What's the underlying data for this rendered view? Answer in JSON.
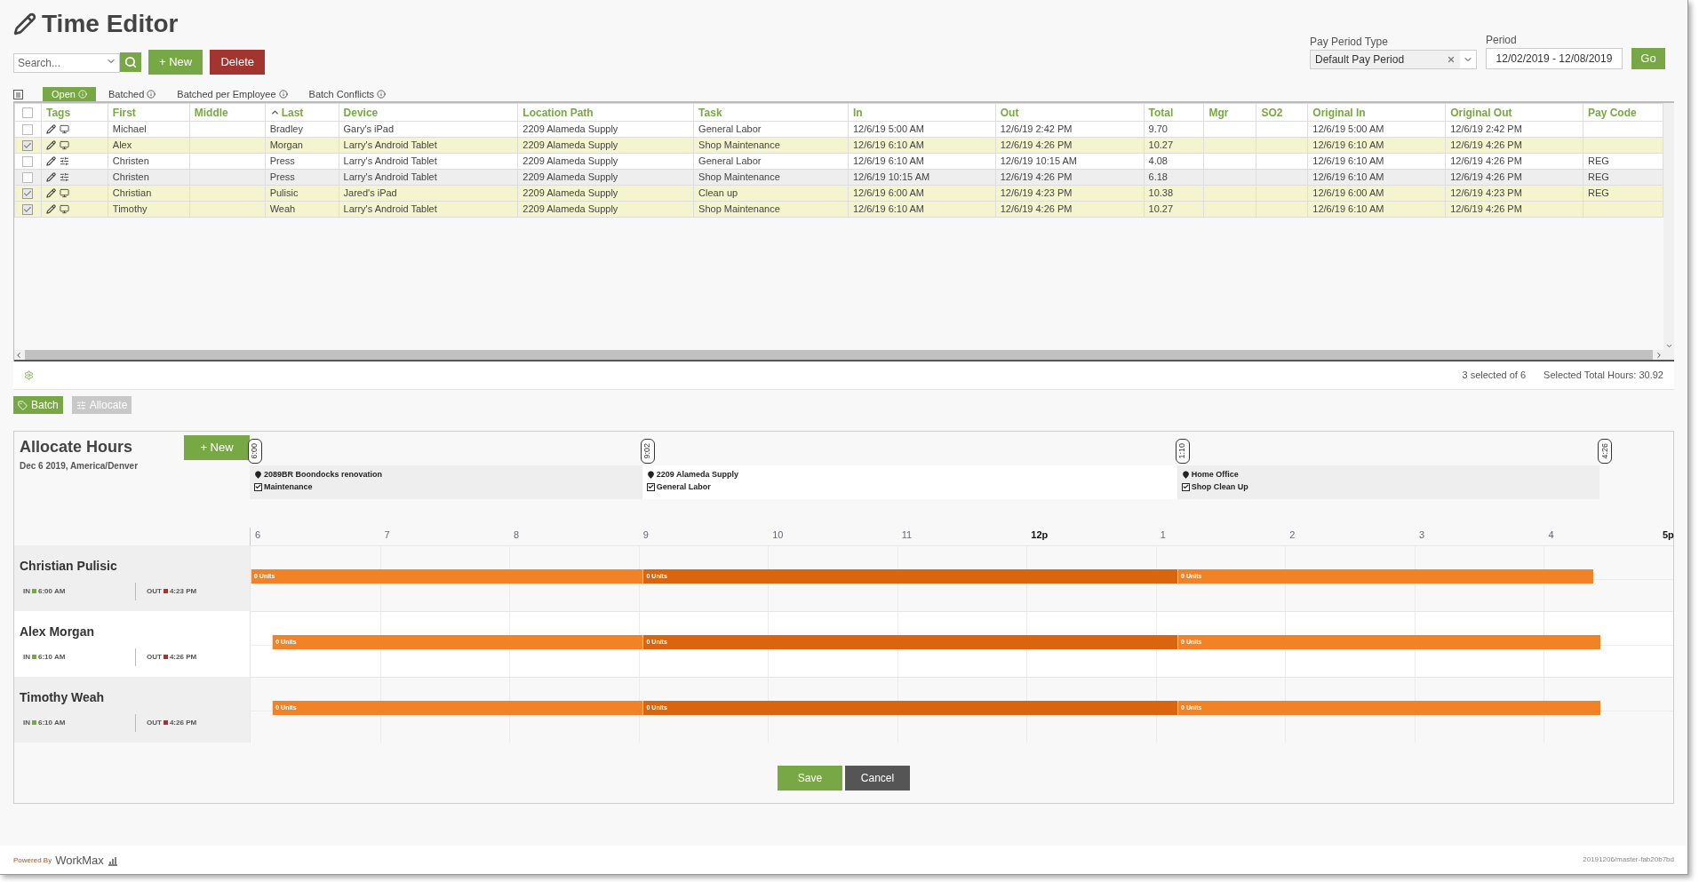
{
  "header": {
    "title": "Time Editor"
  },
  "toolbar": {
    "search": {
      "placeholder": "Search..."
    },
    "buttons": [
      {
        "label": "+ New",
        "kind": "new"
      },
      {
        "label": "Delete",
        "kind": "delete"
      }
    ]
  },
  "filters": {
    "pay_period_type": {
      "label": "Pay Period Type",
      "value": "Default Pay Period"
    },
    "period": {
      "label": "Period",
      "value": "12/02/2019 - 12/08/2019"
    },
    "go": "Go"
  },
  "tabs": [
    {
      "label": "Open",
      "selected": true
    },
    {
      "label": "Batched",
      "selected": false
    },
    {
      "label": "Batched per Employee",
      "selected": false
    },
    {
      "label": "Batch Conflicts",
      "selected": false
    }
  ],
  "table": {
    "select_all": false,
    "columns": [
      {
        "label": "Tags",
        "sorted": false
      },
      {
        "label": "First",
        "sorted": false
      },
      {
        "label": "Middle",
        "sorted": false
      },
      {
        "label": "Last",
        "sorted": true
      },
      {
        "label": "Device",
        "sorted": false
      },
      {
        "label": "Location Path",
        "sorted": false
      },
      {
        "label": "Task",
        "sorted": false
      },
      {
        "label": "In",
        "sorted": false
      },
      {
        "label": "Out",
        "sorted": false
      },
      {
        "label": "Total",
        "sorted": false
      },
      {
        "label": "Mgr",
        "sorted": false
      },
      {
        "label": "SO2",
        "sorted": false
      },
      {
        "label": "Original In",
        "sorted": false
      },
      {
        "label": "Original Out",
        "sorted": false
      },
      {
        "label": "Pay Code",
        "sorted": false
      }
    ],
    "rows": [
      {
        "selected": false,
        "hovered": false,
        "kind": "device",
        "cells": [
          "",
          "Michael",
          "",
          "Bradley",
          "Gary's iPad",
          "2209 Alameda Supply",
          "General Labor",
          "12/6/19 5:00 AM",
          "12/6/19 2:42 PM",
          "9.70",
          "",
          "",
          "12/6/19 5:00 AM",
          "12/6/19 2:42 PM",
          ""
        ]
      },
      {
        "selected": true,
        "hovered": false,
        "kind": "device",
        "cells": [
          "",
          "Alex",
          "",
          "Morgan",
          "Larry's Android Tablet",
          "2209 Alameda Supply",
          "Shop Maintenance",
          "12/6/19 6:10 AM",
          "12/6/19 4:26 PM",
          "10.27",
          "",
          "",
          "12/6/19 6:10 AM",
          "12/6/19 4:26 PM",
          ""
        ]
      },
      {
        "selected": false,
        "hovered": false,
        "kind": "adjusted",
        "cells": [
          "",
          "Christen",
          "",
          "Press",
          "Larry's Android Tablet",
          "2209 Alameda Supply",
          "General Labor",
          "12/6/19 6:10 AM",
          "12/6/19 10:15 AM",
          "4.08",
          "",
          "",
          "12/6/19 6:10 AM",
          "12/6/19 4:26 PM",
          "REG"
        ]
      },
      {
        "selected": false,
        "hovered": true,
        "kind": "adjusted",
        "cells": [
          "",
          "Christen",
          "",
          "Press",
          "Larry's Android Tablet",
          "2209 Alameda Supply",
          "Shop Maintenance",
          "12/6/19 10:15 AM",
          "12/6/19 4:26 PM",
          "6.18",
          "",
          "",
          "12/6/19 6:10 AM",
          "12/6/19 4:26 PM",
          "REG"
        ]
      },
      {
        "selected": true,
        "hovered": false,
        "kind": "device",
        "cells": [
          "",
          "Christian",
          "",
          "Pulisic",
          "Jared's iPad",
          "2209 Alameda Supply",
          "Clean up",
          "12/6/19 6:00 AM",
          "12/6/19 4:23 PM",
          "10.38",
          "",
          "",
          "12/6/19 6:00 AM",
          "12/6/19 4:23 PM",
          "REG"
        ]
      },
      {
        "selected": true,
        "hovered": false,
        "kind": "device",
        "cells": [
          "",
          "Timothy",
          "",
          "Weah",
          "Larry's Android Tablet",
          "2209 Alameda Supply",
          "Shop Maintenance",
          "12/6/19 6:10 AM",
          "12/6/19 4:26 PM",
          "10.27",
          "",
          "",
          "12/6/19 6:10 AM",
          "12/6/19 4:26 PM",
          ""
        ]
      }
    ]
  },
  "status": {
    "selection": "3 selected of 6",
    "total": "Selected Total Hours: 30.92"
  },
  "actions": [
    {
      "label": "Batch",
      "kind": "batch",
      "disabled": false
    },
    {
      "label": "Allocate",
      "kind": "allocate",
      "disabled": true
    }
  ],
  "allocate": {
    "title": "Allocate Hours",
    "subtitle": "Dec 6 2019, America/Denver",
    "new_button": "+ New",
    "markers": [
      "6:00",
      "9:02",
      "1:10",
      "4:26"
    ],
    "allocations": [
      {
        "location": "2089BR Boondocks renovation",
        "task": "Maintenance",
        "checked": true,
        "shaded": true
      },
      {
        "location": "2209 Alameda Supply",
        "task": "General Labor",
        "checked": true,
        "shaded": false
      },
      {
        "location": "Home Office",
        "task": "Shop Clean Up",
        "checked": true,
        "shaded": true
      }
    ],
    "hours": [
      {
        "label": "6",
        "bold": false
      },
      {
        "label": "7",
        "bold": false
      },
      {
        "label": "8",
        "bold": false
      },
      {
        "label": "9",
        "bold": false
      },
      {
        "label": "10",
        "bold": false
      },
      {
        "label": "11",
        "bold": false
      },
      {
        "label": "12p",
        "bold": true
      },
      {
        "label": "1",
        "bold": false
      },
      {
        "label": "2",
        "bold": false
      },
      {
        "label": "3",
        "bold": false
      },
      {
        "label": "4",
        "bold": false
      },
      {
        "label": "5p",
        "bold": true
      }
    ],
    "employees": [
      {
        "name": "Christian Pulisic",
        "in_label": "IN",
        "in": "6:00 AM",
        "out_label": "OUT",
        "out": "4:23 PM",
        "shaded": true,
        "segments": [
          {
            "label": "0 Units",
            "color": "#f28226"
          },
          {
            "label": "0 Units",
            "color": "#d9650e"
          },
          {
            "label": "0 Units",
            "color": "#f28226"
          }
        ]
      },
      {
        "name": "Alex Morgan",
        "in_label": "IN",
        "in": "6:10 AM",
        "out_label": "OUT",
        "out": "4:26 PM",
        "shaded": false,
        "segments": [
          {
            "label": "0 Units",
            "color": "#f28226"
          },
          {
            "label": "0 Units",
            "color": "#d9650e"
          },
          {
            "label": "0 Units",
            "color": "#f28226"
          }
        ]
      },
      {
        "name": "Timothy Weah",
        "in_label": "IN",
        "in": "6:10 AM",
        "out_label": "OUT",
        "out": "4:26 PM",
        "shaded": true,
        "segments": [
          {
            "label": "0 Units",
            "color": "#f28226"
          },
          {
            "label": "0 Units",
            "color": "#d9650e"
          },
          {
            "label": "0 Units",
            "color": "#f28226"
          }
        ]
      }
    ]
  },
  "form_buttons": [
    {
      "label": "Save",
      "kind": "primary"
    },
    {
      "label": "Cancel",
      "kind": "secondary"
    }
  ],
  "footer": {
    "powered_by": "Powered By",
    "brand": "WorkMax",
    "version": "20191206/master-fab20b7bd"
  }
}
